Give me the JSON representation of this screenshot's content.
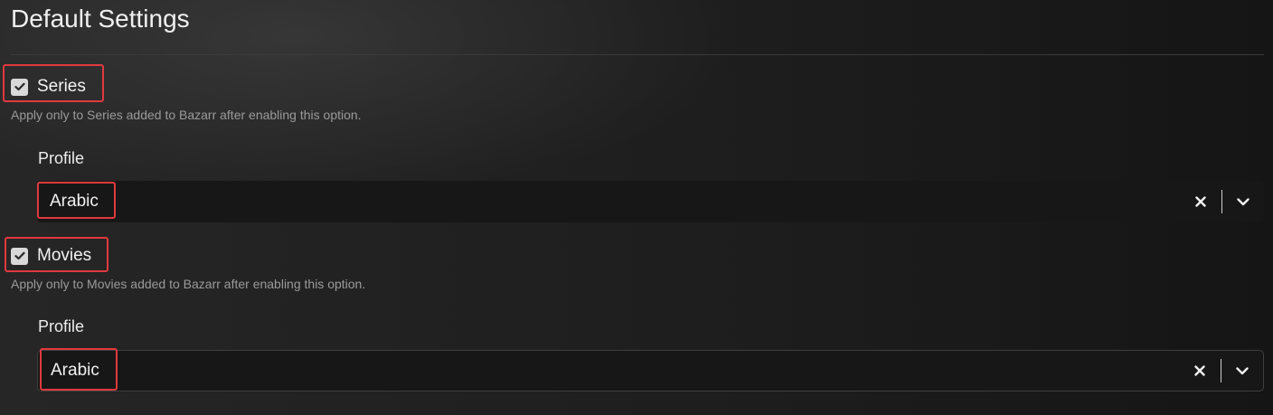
{
  "page": {
    "title": "Default Settings"
  },
  "series": {
    "checkbox_label": "Series",
    "checked": true,
    "hint": "Apply only to Series added to Bazarr after enabling this option.",
    "profile_label": "Profile",
    "profile_value": "Arabic"
  },
  "movies": {
    "checkbox_label": "Movies",
    "checked": true,
    "hint": "Apply only to Movies added to Bazarr after enabling this option.",
    "profile_label": "Profile",
    "profile_value": "Arabic"
  },
  "icons": {
    "checkbox": "checkmark-icon",
    "clear": "close-icon",
    "dropdown": "chevron-down-icon"
  },
  "colors": {
    "highlight": "#e0393e",
    "checkbox": "#d9d9d9"
  }
}
